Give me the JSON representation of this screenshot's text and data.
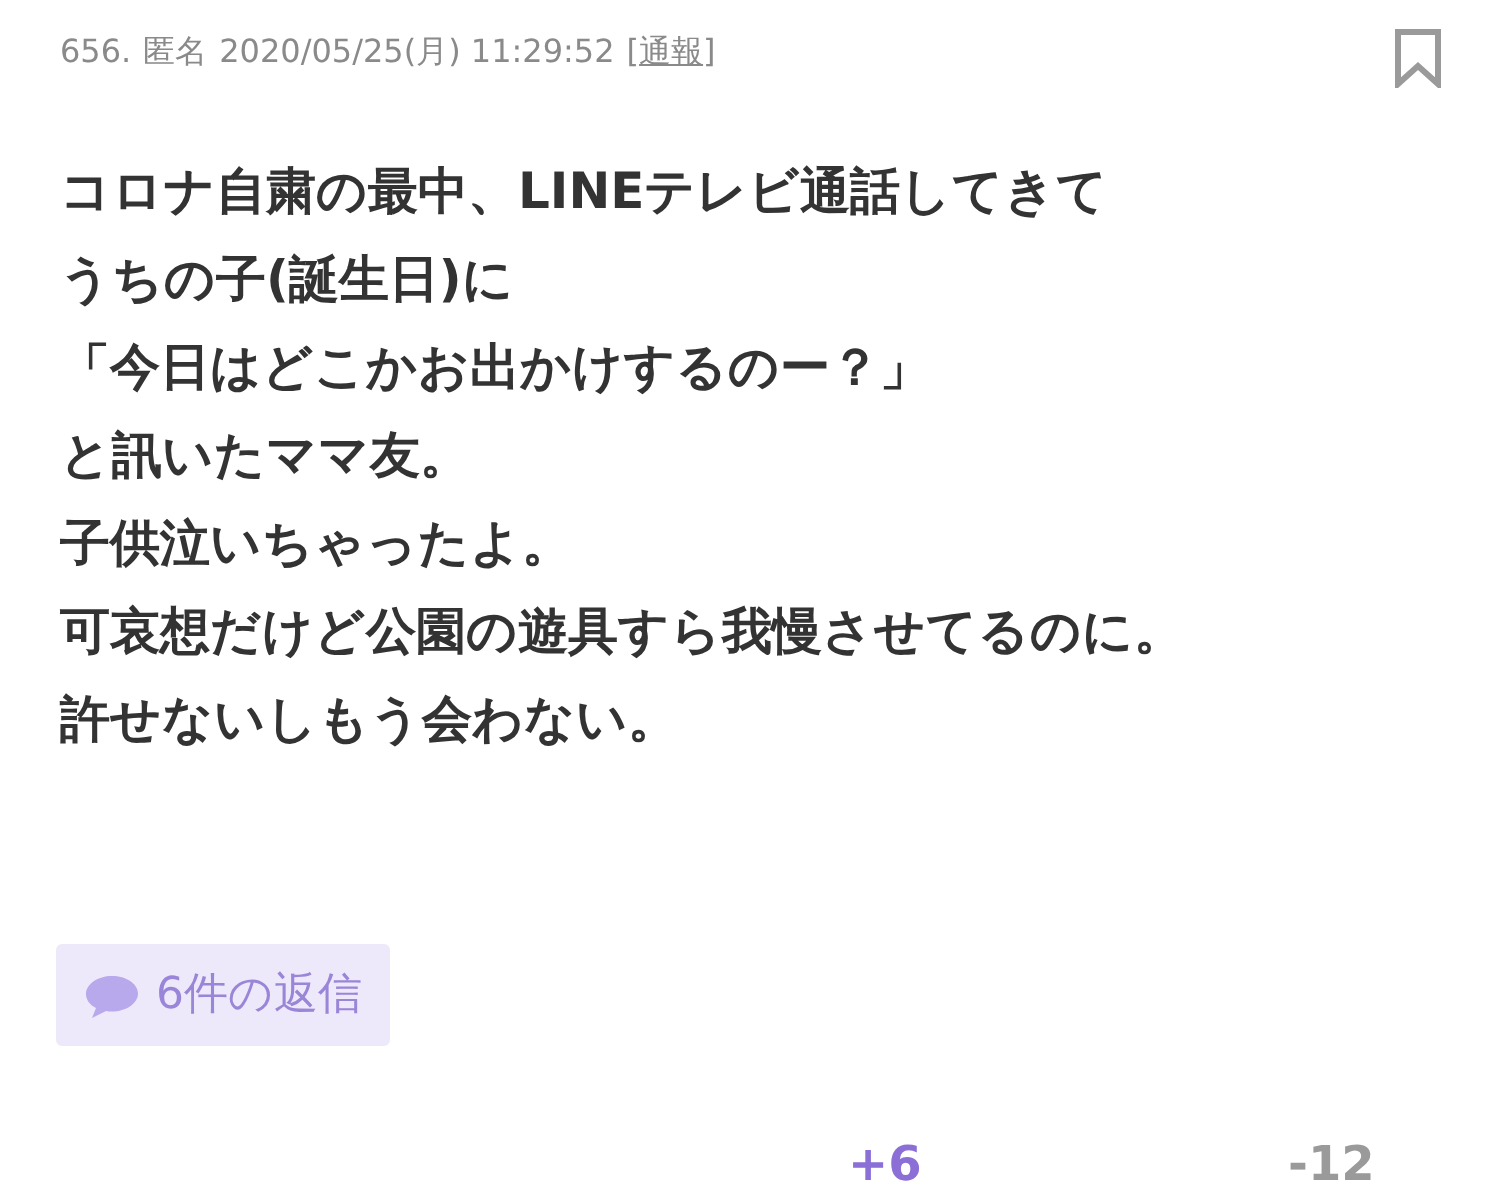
{
  "header": {
    "number": "656.",
    "author": "匿名",
    "timestamp": "2020/05/25(月) 11:29:52",
    "report_open": "[",
    "report_link": "通報",
    "report_close": "]"
  },
  "body": [
    "コロナ自粛の最中、LINEテレビ通話してきて",
    "うちの子(誕生日)に",
    "「今日はどこかお出かけするのー？」",
    "と訊いたママ友。",
    "子供泣いちゃったよ。",
    "可哀想だけど公園の遊具すら我慢させてるのに。",
    "許せないしもう会わない。"
  ],
  "replies": {
    "label": "6件の返信"
  },
  "votes": {
    "up": "+6",
    "down": "-12"
  }
}
